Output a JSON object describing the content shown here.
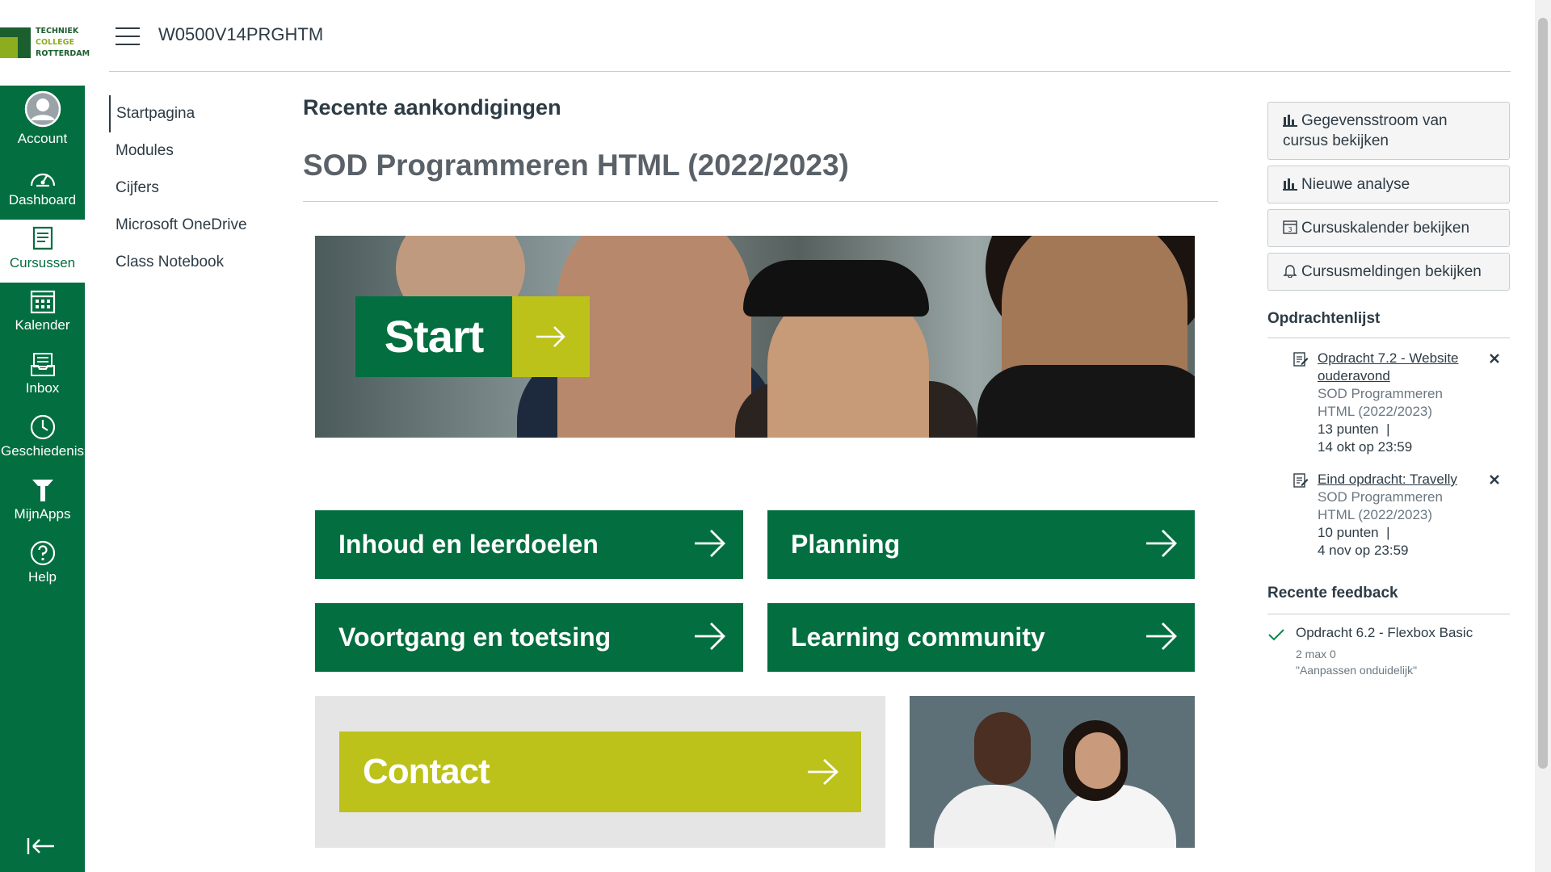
{
  "logo": {
    "line1": "TECHNIEK",
    "line2": "COLLEGE",
    "line3": "ROTTERDAM"
  },
  "global_nav": {
    "items": [
      {
        "label": "Account",
        "icon": "account-icon"
      },
      {
        "label": "Dashboard",
        "icon": "dashboard-icon"
      },
      {
        "label": "Cursussen",
        "icon": "courses-icon",
        "active": true
      },
      {
        "label": "Kalender",
        "icon": "calendar-icon"
      },
      {
        "label": "Inbox",
        "icon": "inbox-icon"
      },
      {
        "label": "Geschiedenis",
        "icon": "history-icon"
      },
      {
        "label": "MijnApps",
        "icon": "apps-icon"
      },
      {
        "label": "Help",
        "icon": "help-icon"
      }
    ]
  },
  "header": {
    "course_code": "W0500V14PRGHTM"
  },
  "course_nav": {
    "items": [
      {
        "label": "Startpagina",
        "active": true
      },
      {
        "label": "Modules"
      },
      {
        "label": "Cijfers"
      },
      {
        "label": "Microsoft OneDrive"
      },
      {
        "label": "Class Notebook"
      }
    ]
  },
  "main": {
    "recent_announcements_title": "Recente aankondigingen",
    "course_title": "SOD Programmeren HTML (2022/2023)",
    "start_label": "Start",
    "tiles": [
      {
        "label": "Inhoud en leerdoelen"
      },
      {
        "label": "Planning"
      },
      {
        "label": "Voortgang en toetsing"
      },
      {
        "label": "Learning community"
      }
    ],
    "contact_label": "Contact"
  },
  "sidebar": {
    "buttons": [
      {
        "label": "Gegevensstroom van cursus bekijken",
        "icon": "bar-chart-icon"
      },
      {
        "label": "Nieuwe analyse",
        "icon": "bar-chart-icon"
      },
      {
        "label": "Cursuskalender bekijken",
        "icon": "calendar-icon"
      },
      {
        "label": "Cursusmeldingen bekijken",
        "icon": "bell-icon"
      }
    ],
    "todo_heading": "Opdrachtenlijst",
    "todos": [
      {
        "title": "Opdracht 7.2 - Website ouderavond",
        "course": "SOD Programmeren HTML (2022/2023)",
        "points": "13 punten",
        "separator": "|",
        "due": "14 okt op 23:59"
      },
      {
        "title": "Eind opdracht: Travelly",
        "course": "SOD Programmeren HTML (2022/2023)",
        "points": "10 punten",
        "separator": "|",
        "due": "4 nov op 23:59"
      }
    ],
    "feedback_heading": "Recente feedback",
    "feedback": {
      "title": "Opdracht 6.2 - Flexbox Basic",
      "score": "2 max 0",
      "comment": "\"Aanpassen onduidelijk\""
    }
  },
  "colors": {
    "brand_green": "#036e3f",
    "accent_lime": "#bcc219",
    "text": "#2d3b45"
  }
}
